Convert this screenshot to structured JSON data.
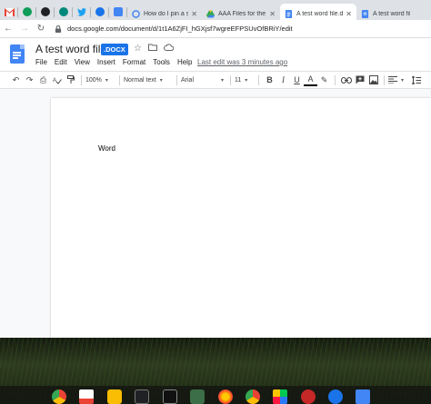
{
  "browser": {
    "tabs": [
      {
        "title": "How do I pin a sm",
        "active": false
      },
      {
        "title": "AAA Files for the",
        "active": false
      },
      {
        "title": "A test word file.d",
        "active": true
      },
      {
        "title": "A test word file.d",
        "active": false
      }
    ],
    "url": "docs.google.com/document/d/1t1A6ZjFI_hGXjsf7wgreEFPSUvOfBRiY/edit"
  },
  "docs": {
    "title": "A test word file",
    "badge": ".DOCX",
    "menu": [
      "File",
      "Edit",
      "View",
      "Insert",
      "Format",
      "Tools",
      "Help"
    ],
    "last_edit": "Last edit was 3 minutes ago",
    "toolbar": {
      "zoom": "100%",
      "style": "Normal text",
      "font": "Arial",
      "size": "11",
      "bold": "B",
      "italic": "I",
      "underline": "U",
      "text_color": "A"
    },
    "body_text": "Word"
  },
  "colors": {
    "docs_blue": "#4285f4",
    "badge_blue": "#1a73e8",
    "tabstrip": "#dee1e6"
  }
}
